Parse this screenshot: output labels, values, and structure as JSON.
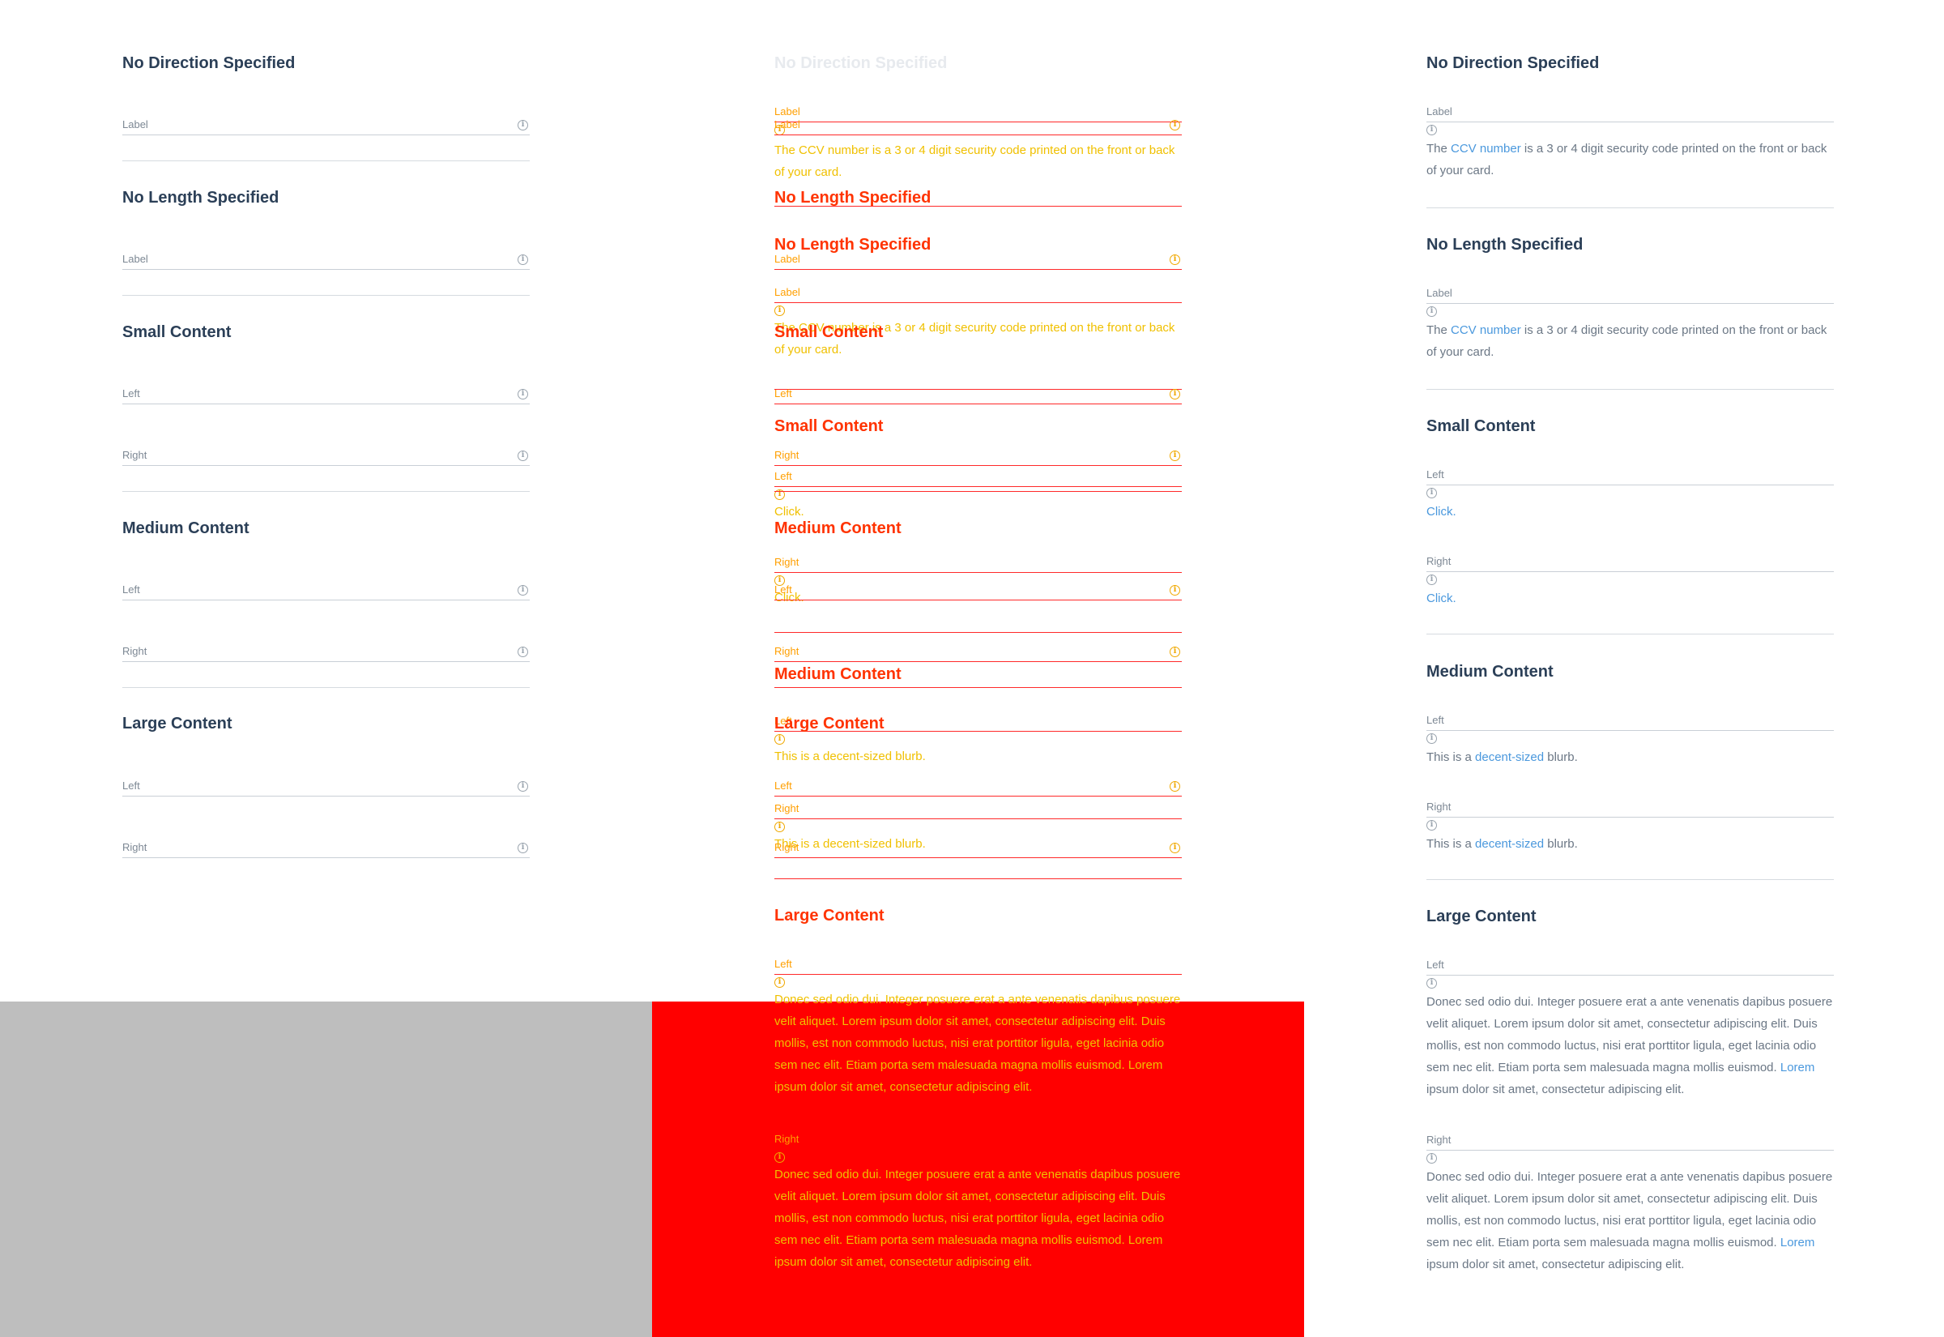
{
  "colors": {
    "heading": "#2b3f57",
    "label": "#7d8894",
    "body_text": "#6b7785",
    "link": "#4a98dd",
    "overlay_red": "#ff0000",
    "overlay_gray": "#bebebe",
    "overlay_text": "#f0c000"
  },
  "sections": {
    "no_direction": "No Direction Specified",
    "no_length": "No Length Specified",
    "small": "Small Content",
    "medium": "Medium Content",
    "large": "Large Content"
  },
  "labels": {
    "label": "Label",
    "left": "Left",
    "right": "Right"
  },
  "help": {
    "ccv_prefix": "The ",
    "ccv_link": "CCV number",
    "ccv_suffix": " is a 3 or 4 digit security code printed on the front or back of your card.",
    "small_link": "Click.",
    "medium_prefix": "This is a ",
    "medium_link": "decent-sized",
    "medium_suffix": " blurb.",
    "large_text": "Donec sed odio dui. Integer posuere erat a ante venenatis dapibus posuere velit aliquet. Lorem ipsum dolor sit amet, consectetur adipiscing elit. Duis mollis, est non commodo luctus, nisi erat porttitor ligula, eget lacinia odio sem nec elit. Etiam porta sem malesuada magna mollis euismod. ",
    "large_link": "Lorem",
    "large_suffix": " ipsum dolor sit amet, consectetur adipiscing elit."
  },
  "icons": {
    "info": "info-circle-icon"
  }
}
